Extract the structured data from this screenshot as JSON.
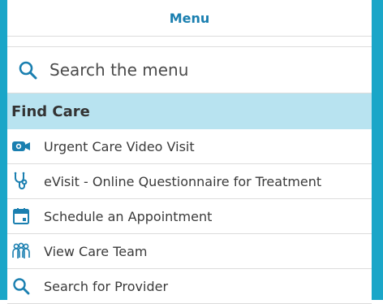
{
  "menu": {
    "title": "Menu"
  },
  "search": {
    "placeholder": "Search the menu"
  },
  "section": {
    "title": "Find Care",
    "items": [
      {
        "label": "Urgent Care Video Visit",
        "icon": "video-camera-icon"
      },
      {
        "label": "eVisit - Online Questionnaire for Treatment",
        "icon": "stethoscope-icon"
      },
      {
        "label": "Schedule an Appointment",
        "icon": "calendar-icon"
      },
      {
        "label": "View Care Team",
        "icon": "care-team-icon"
      },
      {
        "label": "Search for Provider",
        "icon": "search-icon"
      }
    ]
  },
  "colors": {
    "accent": "#1aa6c8",
    "title_text": "#1a7fb0",
    "section_bg": "#b8e3f0"
  }
}
